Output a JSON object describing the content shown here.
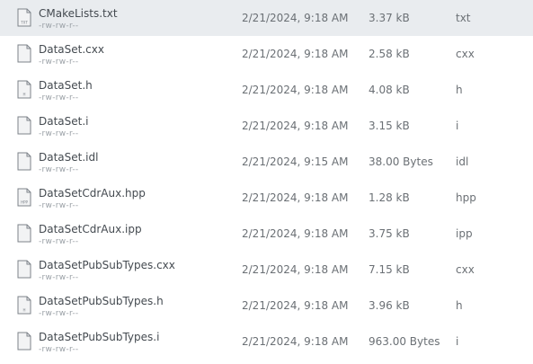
{
  "files": [
    {
      "name": "CMakeLists.txt",
      "permissions": "-rw-rw-r--",
      "modified": "2/21/2024, 9:18 AM",
      "size": "3.37 kB",
      "type": "txt",
      "icon": "txt-file-icon",
      "icon_label": "TXT",
      "selected": true
    },
    {
      "name": "DataSet.cxx",
      "permissions": "-rw-rw-r--",
      "modified": "2/21/2024, 9:18 AM",
      "size": "2.58 kB",
      "type": "cxx",
      "icon": "file-icon",
      "icon_label": "",
      "selected": false
    },
    {
      "name": "DataSet.h",
      "permissions": "-rw-rw-r--",
      "modified": "2/21/2024, 9:18 AM",
      "size": "4.08 kB",
      "type": "h",
      "icon": "header-file-icon",
      "icon_label": "H",
      "selected": false
    },
    {
      "name": "DataSet.i",
      "permissions": "-rw-rw-r--",
      "modified": "2/21/2024, 9:18 AM",
      "size": "3.15 kB",
      "type": "i",
      "icon": "file-icon",
      "icon_label": "",
      "selected": false
    },
    {
      "name": "DataSet.idl",
      "permissions": "-rw-rw-r--",
      "modified": "2/21/2024, 9:15 AM",
      "size": "38.00 Bytes",
      "type": "idl",
      "icon": "file-icon",
      "icon_label": "",
      "selected": false
    },
    {
      "name": "DataSetCdrAux.hpp",
      "permissions": "-rw-rw-r--",
      "modified": "2/21/2024, 9:18 AM",
      "size": "1.28 kB",
      "type": "hpp",
      "icon": "hpp-file-icon",
      "icon_label": "HPP",
      "selected": false
    },
    {
      "name": "DataSetCdrAux.ipp",
      "permissions": "-rw-rw-r--",
      "modified": "2/21/2024, 9:18 AM",
      "size": "3.75 kB",
      "type": "ipp",
      "icon": "file-icon",
      "icon_label": "",
      "selected": false
    },
    {
      "name": "DataSetPubSubTypes.cxx",
      "permissions": "-rw-rw-r--",
      "modified": "2/21/2024, 9:18 AM",
      "size": "7.15 kB",
      "type": "cxx",
      "icon": "file-icon",
      "icon_label": "",
      "selected": false
    },
    {
      "name": "DataSetPubSubTypes.h",
      "permissions": "-rw-rw-r--",
      "modified": "2/21/2024, 9:18 AM",
      "size": "3.96 kB",
      "type": "h",
      "icon": "header-file-icon",
      "icon_label": "H",
      "selected": false
    },
    {
      "name": "DataSetPubSubTypes.i",
      "permissions": "-rw-rw-r--",
      "modified": "2/21/2024, 9:18 AM",
      "size": "963.00 Bytes",
      "type": "i",
      "icon": "file-icon",
      "icon_label": "",
      "selected": false
    }
  ],
  "colors": {
    "selected_row": "#e9ecef",
    "name_text": "#444a50",
    "meta_text": "#6b7075",
    "permission_text": "#9aa0a6",
    "icon_fill": "#f2f3f4",
    "icon_stroke": "#7d838a"
  }
}
